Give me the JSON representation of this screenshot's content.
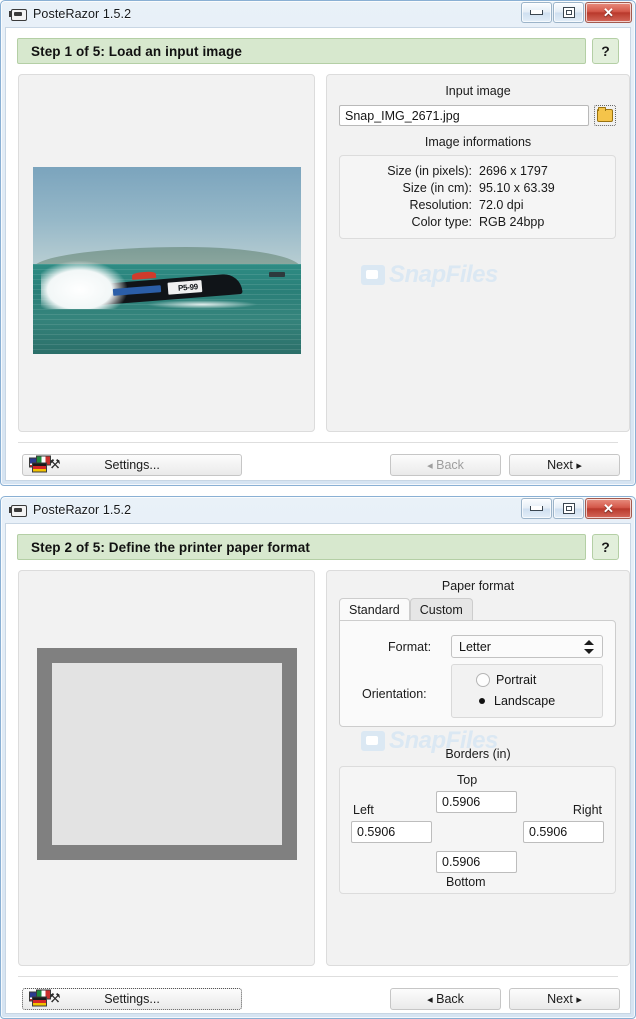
{
  "app": {
    "title": "PosteRazor 1.5.2",
    "icon": "printer-icon"
  },
  "window_buttons": {
    "minimize": "minimize-icon",
    "maximize": "maximize-icon",
    "close": "✕"
  },
  "watermark": "SnapFiles",
  "window1": {
    "step_title": "Step 1 of 5: Load an input image",
    "help_label": "?",
    "input_image": {
      "group_label": "Input image",
      "filename": "Snap_IMG_2671.jpg",
      "browse_icon": "folder-icon"
    },
    "image_information": {
      "group_label": "Image informations",
      "rows": [
        {
          "key": "Size (in pixels):",
          "value": "2696 x 1797"
        },
        {
          "key": "Size (in cm):",
          "value": "95.10 x 63.39"
        },
        {
          "key": "Resolution:",
          "value": "72.0 dpi"
        },
        {
          "key": "Color type:",
          "value": "RGB 24bpp"
        }
      ]
    },
    "preview": {
      "alt": "speedboat racing on sea",
      "boat_number": "P5-99"
    },
    "footer": {
      "settings_label": "Settings...",
      "back_label": "Back",
      "next_label": "Next",
      "back_enabled": false,
      "back_arrow": "◂",
      "next_arrow": "▸"
    }
  },
  "window2": {
    "step_title": "Step 2 of 5: Define the printer paper format",
    "help_label": "?",
    "paper_format": {
      "group_label": "Paper format",
      "tabs": [
        {
          "label": "Standard",
          "active": true
        },
        {
          "label": "Custom",
          "active": false
        }
      ],
      "format_label": "Format:",
      "format_value": "Letter",
      "orientation_label": "Orientation:",
      "orientation_options": [
        {
          "label": "Portrait",
          "selected": false
        },
        {
          "label": "Landscape",
          "selected": true
        }
      ]
    },
    "borders": {
      "group_label": "Borders (in)",
      "top_label": "Top",
      "top_value": "0.5906",
      "left_label": "Left",
      "left_value": "0.5906",
      "right_label": "Right",
      "right_value": "0.5906",
      "bottom_label": "Bottom",
      "bottom_value": "0.5906"
    },
    "footer": {
      "settings_label": "Settings...",
      "back_label": "Back",
      "next_label": "Next",
      "back_enabled": true,
      "back_arrow": "◂",
      "next_arrow": "▸"
    }
  }
}
